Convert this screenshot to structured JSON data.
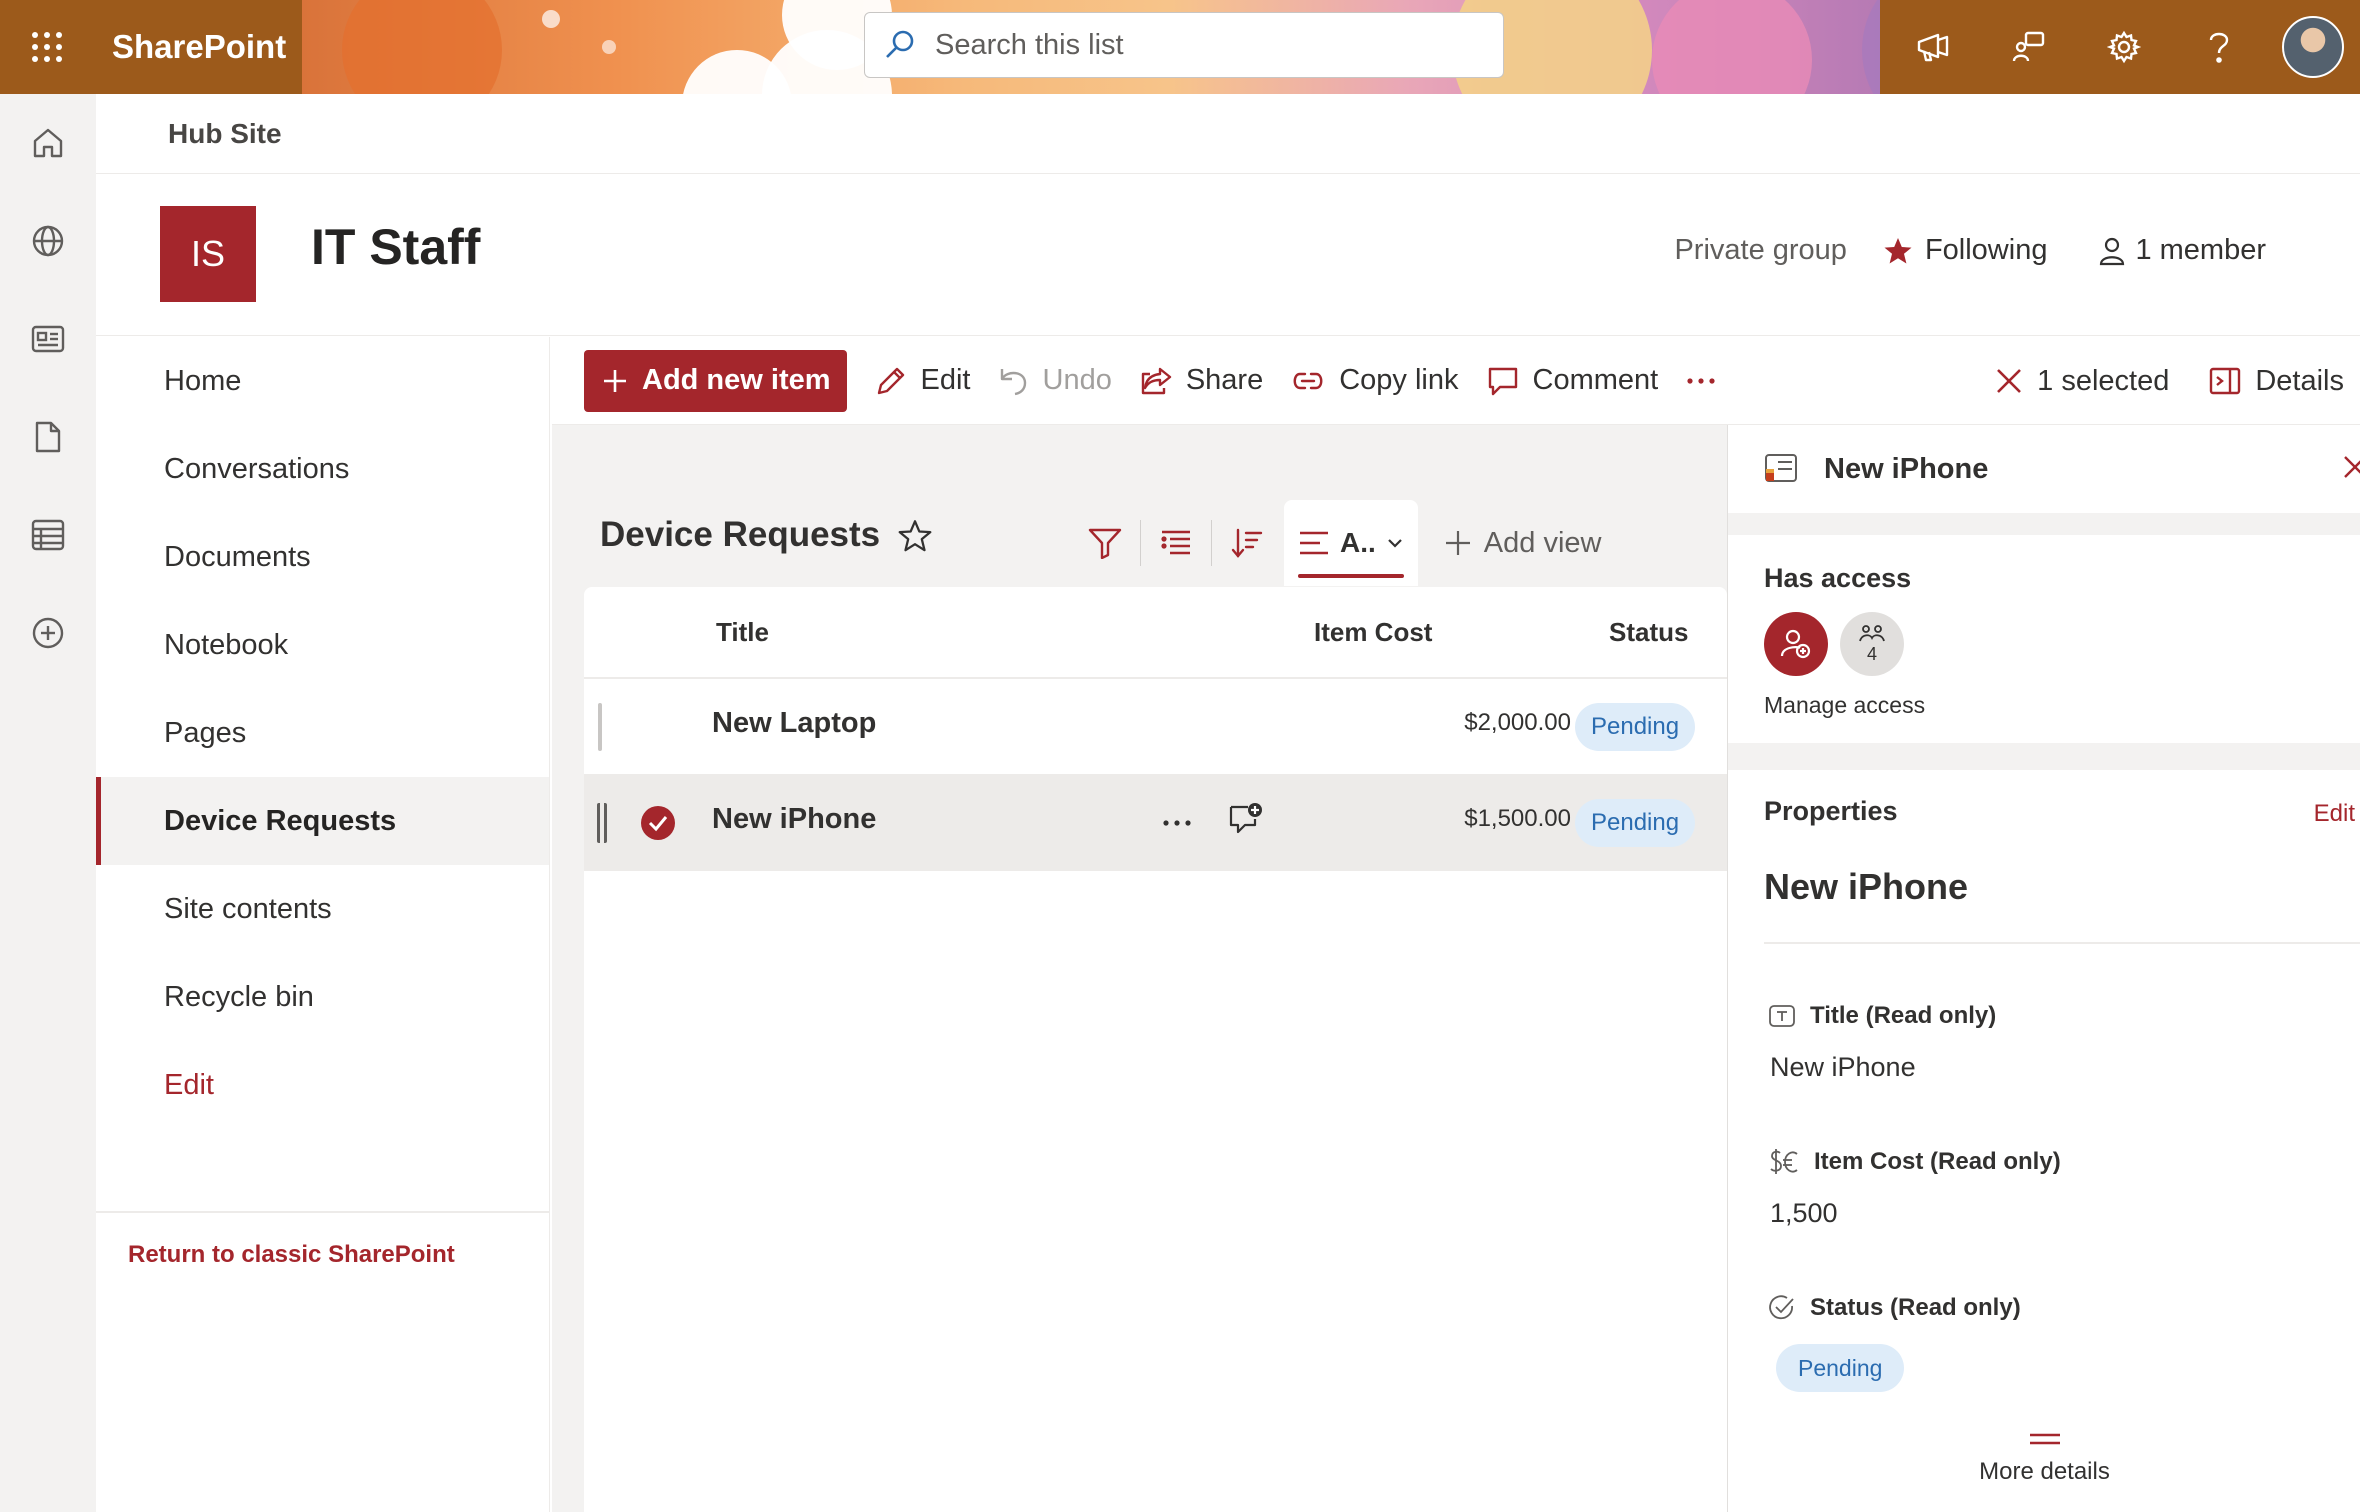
{
  "suite": {
    "app_name": "SharePoint",
    "search_placeholder": "Search this list"
  },
  "hub": {
    "title": "Hub Site"
  },
  "site": {
    "logo_initials": "IS",
    "title": "IT Staff",
    "privacy": "Private group",
    "following_label": "Following",
    "members_label": "1 member"
  },
  "nav": {
    "items": [
      {
        "label": "Home"
      },
      {
        "label": "Conversations"
      },
      {
        "label": "Documents"
      },
      {
        "label": "Notebook"
      },
      {
        "label": "Pages"
      },
      {
        "label": "Device Requests"
      },
      {
        "label": "Site contents"
      },
      {
        "label": "Recycle bin"
      },
      {
        "label": "Edit"
      }
    ],
    "classic_link": "Return to classic SharePoint"
  },
  "commands": {
    "add_new_item": "Add new item",
    "edit": "Edit",
    "undo": "Undo",
    "share": "Share",
    "copy_link": "Copy link",
    "comment": "Comment",
    "selected_count": "1 selected",
    "details": "Details"
  },
  "list": {
    "title": "Device Requests",
    "view_tab_label": "A..",
    "add_view": "Add view",
    "columns": [
      "Title",
      "Item Cost",
      "Status"
    ],
    "rows": [
      {
        "title": "New Laptop",
        "cost": "$2,000.00",
        "status": "Pending"
      },
      {
        "title": "New iPhone",
        "cost": "$1,500.00",
        "status": "Pending"
      }
    ]
  },
  "details": {
    "item_title": "New iPhone",
    "has_access_title": "Has access",
    "group_count": "4",
    "manage_access": "Manage access",
    "properties_title": "Properties",
    "properties_edit": "Edit",
    "fields": [
      {
        "label": "Title (Read only)",
        "value": "New iPhone"
      },
      {
        "label": "Item Cost (Read only)",
        "value": "1,500"
      },
      {
        "label": "Status (Read only)",
        "value": "Pending"
      }
    ],
    "more_details": "More details"
  },
  "colors": {
    "accent": "#a4262c",
    "suite_bar": "#9c5a1b",
    "status_pill_bg": "#deecf9",
    "status_pill_text": "#2b6cb0"
  }
}
